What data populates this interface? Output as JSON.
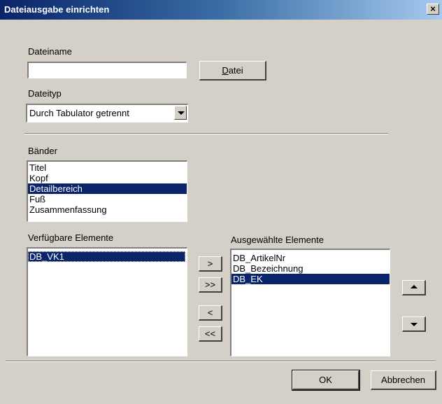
{
  "window": {
    "title": "Dateiausgabe einrichten",
    "close_label": "×"
  },
  "filename": {
    "label": "Dateiname",
    "value": "",
    "button_label": "Datei"
  },
  "filetype": {
    "label": "Dateityp",
    "selected": "Durch Tabulator getrennt"
  },
  "bands": {
    "label": "Bänder",
    "items": [
      "Titel",
      "Kopf",
      "Detailbereich",
      "Fuß",
      "Zusammenfassung"
    ],
    "selected_index": 2
  },
  "available": {
    "label": "Verfügbare Elemente",
    "items": [
      "DB_VK1"
    ]
  },
  "selected_elements": {
    "label": "Ausgewählte Elemente",
    "items": [
      "DB_ArtikelNr",
      "DB_Bezeichnung",
      "DB_EK"
    ],
    "selected_index": 2
  },
  "transfer_buttons": {
    "add": ">",
    "add_all": ">>",
    "remove": "<",
    "remove_all": "<<"
  },
  "footer": {
    "ok": "OK",
    "cancel": "Abbrechen"
  }
}
